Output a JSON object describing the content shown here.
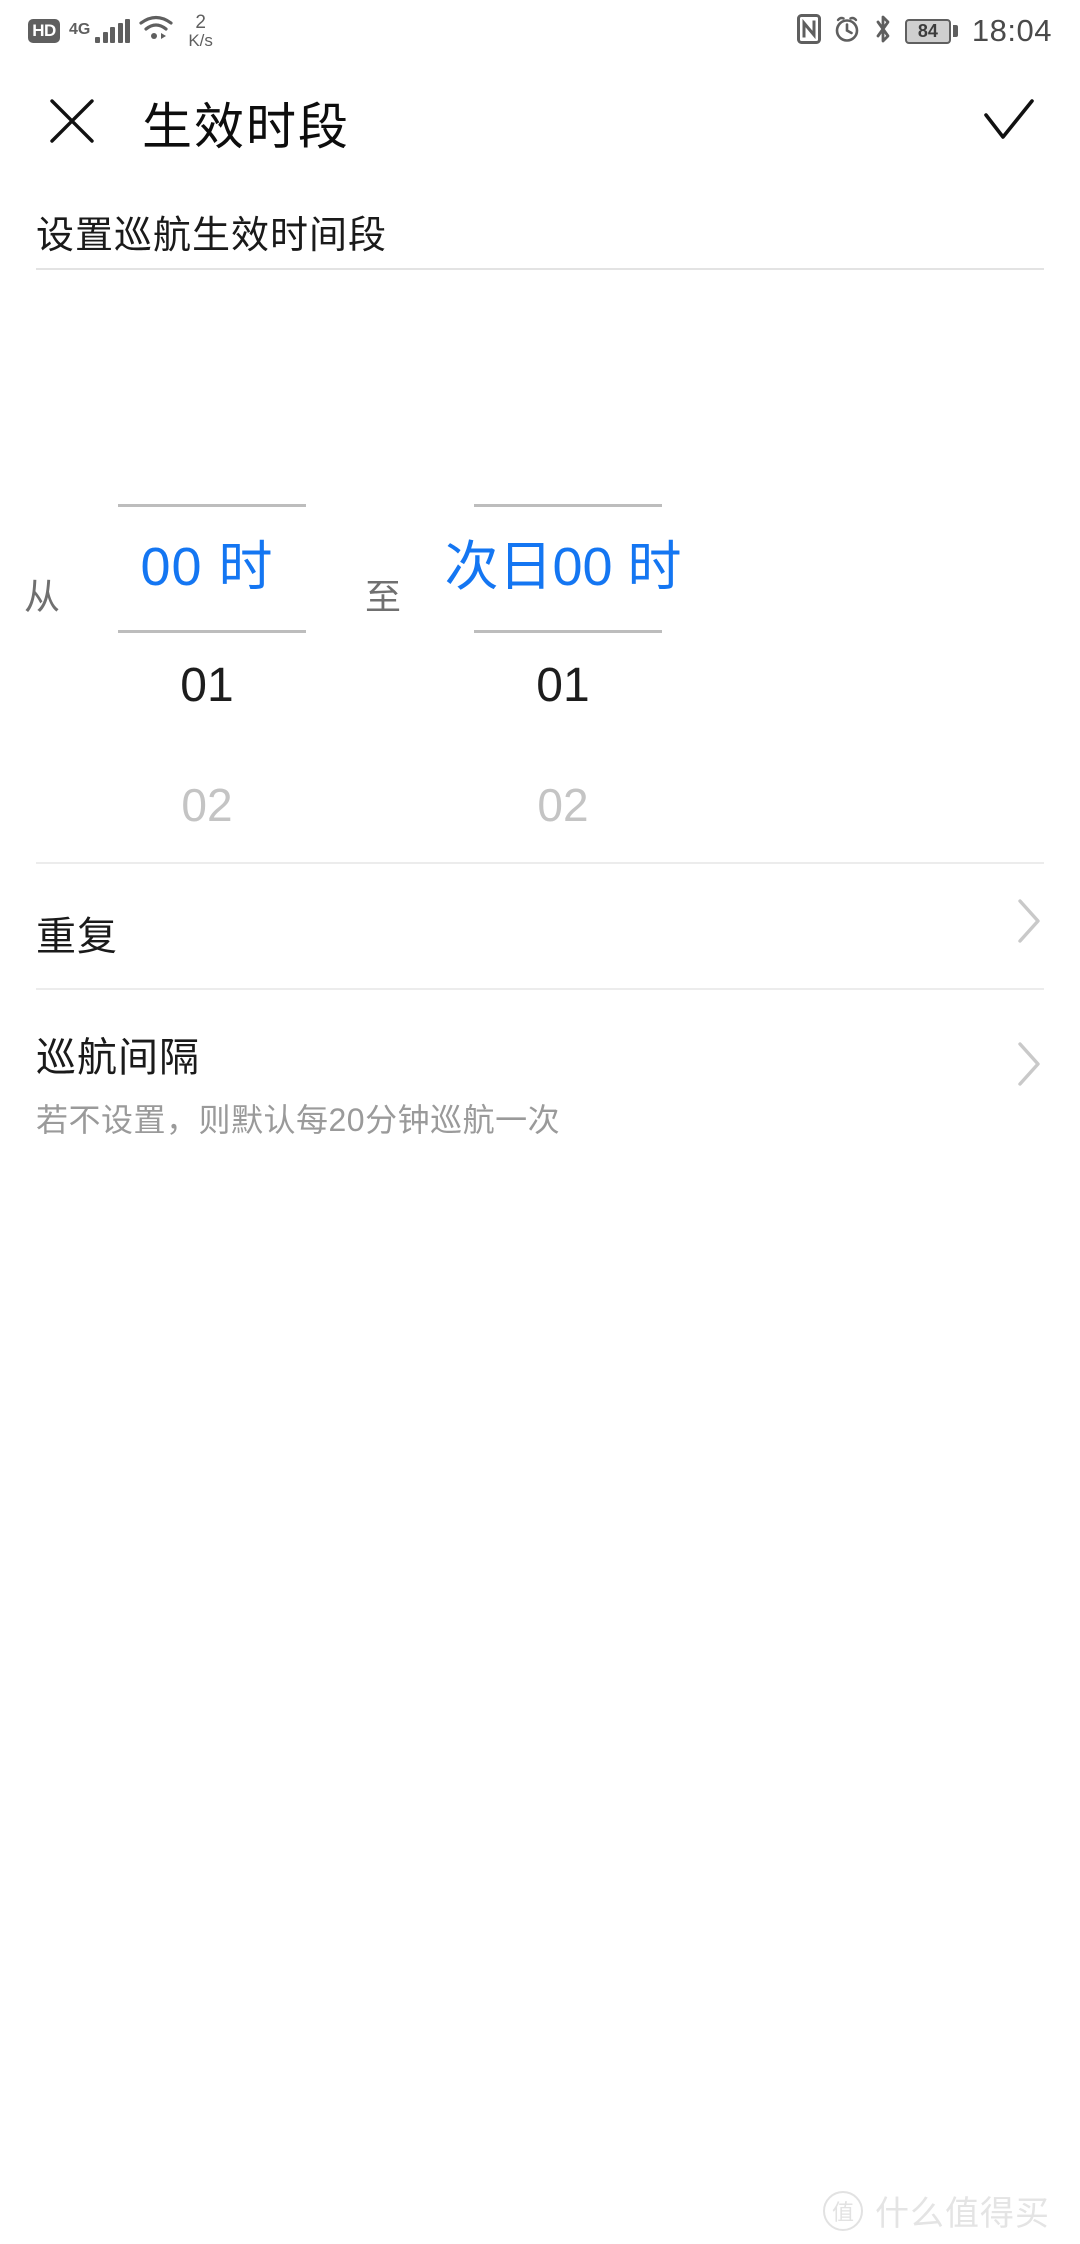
{
  "status_bar": {
    "hd_label": "HD",
    "network_type": "4G",
    "signal_icon": "signal-bars-icon",
    "wifi_icon": "wifi-icon",
    "data_speed_value": "2",
    "data_speed_unit": "K/s",
    "nfc_icon": "nfc-icon",
    "alarm_icon": "alarm-clock-icon",
    "bluetooth_icon": "bluetooth-icon",
    "battery_level": "84",
    "time": "18:04"
  },
  "title_bar": {
    "close_icon": "close-icon",
    "title": "生效时段",
    "confirm_icon": "check-icon"
  },
  "subtitle": {
    "text": "设置巡航生效时间段"
  },
  "time_picker": {
    "from_label": "从",
    "to_label": "至",
    "start": {
      "selected": "00 时",
      "next": "01",
      "far": "02"
    },
    "end": {
      "selected": "次日00 时",
      "next": "01",
      "far": "02"
    },
    "accent_color": "#1476f2"
  },
  "list_rows": [
    {
      "name": "repeat",
      "title": "重复",
      "subtitle": "",
      "chevron_icon": "chevron-right-icon"
    },
    {
      "name": "cruise-interval",
      "title": "巡航间隔",
      "subtitle": "若不设置，则默认每20分钟巡航一次",
      "chevron_icon": "chevron-right-icon"
    }
  ],
  "watermark": {
    "badge": "值",
    "text": "什么值得买"
  }
}
